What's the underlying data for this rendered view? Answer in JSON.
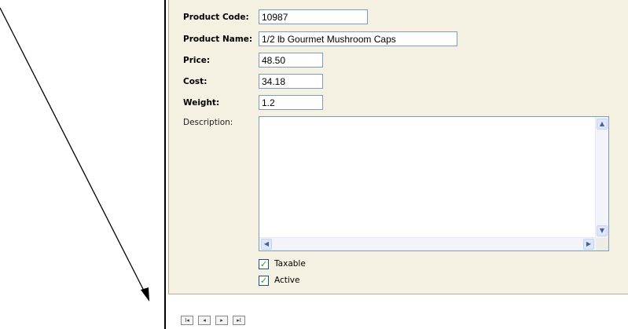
{
  "form": {
    "product_code": {
      "label": "Product Code:",
      "value": "10987"
    },
    "product_name": {
      "label": "Product Name:",
      "value": "1/2 lb Gourmet Mushroom Caps"
    },
    "price": {
      "label": "Price:",
      "value": "48.50"
    },
    "cost": {
      "label": "Cost:",
      "value": "34.18"
    },
    "weight": {
      "label": "Weight:",
      "value": "1.2"
    },
    "description": {
      "label": "Description:",
      "value": ""
    },
    "taxable": {
      "label": "Taxable",
      "checked": true
    },
    "active": {
      "label": "Active",
      "checked": true
    }
  },
  "pager": {
    "first": "I◂",
    "prev": "◂",
    "next": "▸",
    "last": "▸I"
  },
  "colors": {
    "panel_bg": "#f4f0e2",
    "field_border": "#7f9db9",
    "check_mark": "#21a121"
  }
}
